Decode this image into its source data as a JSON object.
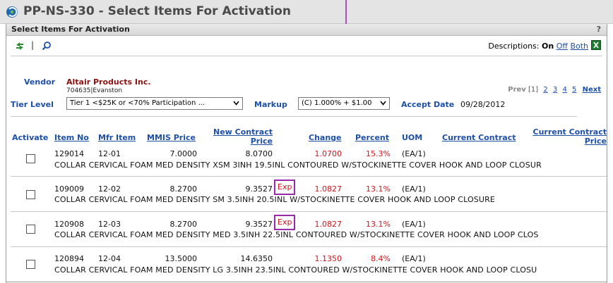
{
  "window": {
    "title": "PP-NS-330 - Select Items For Activation"
  },
  "panel": {
    "title": "Select Items For Activation",
    "help": "?"
  },
  "toolbar": {
    "separator": "|",
    "descriptions_label": "Descriptions:",
    "on": "On",
    "off": "Off",
    "both": "Both"
  },
  "pager": {
    "prev": "Prev",
    "current": "[1]",
    "pages": [
      "2",
      "3",
      "4",
      "5"
    ],
    "next": "Next"
  },
  "vendor": {
    "label": "Vendor",
    "name": "Altair Products Inc.",
    "sub": "704635|Evanston"
  },
  "tier": {
    "label": "Tier Level",
    "value": "Tier 1 <$25K or <70% Participation ..."
  },
  "markup": {
    "label": "Markup",
    "value": "(C) 1.000% + $1.00"
  },
  "accept": {
    "label": "Accept Date",
    "value": "09/28/2012"
  },
  "columns": {
    "activate": "Activate",
    "item_no": "Item No",
    "mfr_item": "Mfr Item",
    "mmis_price": "MMIS Price",
    "new_contract_price_1": "New Contract",
    "new_contract_price_2": "Price",
    "change": "Change",
    "percent": "Percent",
    "uom": "UOM",
    "current_contract": "Current Contract",
    "current_contract_price_1": "Current Contract",
    "current_contract_price_2": "Price"
  },
  "rows": [
    {
      "item_no": "129014",
      "mfr_item": "12-01",
      "mmis_price": "7.0000",
      "new_price": "8.0700",
      "exp": "",
      "change": "1.0700",
      "percent": "15.3%",
      "uom": "(EA/1)",
      "description": "COLLAR CERVICAL FOAM MED DENSITY XSM 3INH 19.5INL CONTOURED W/STOCKINETTE COVER HOOK AND LOOP CLOSUR"
    },
    {
      "item_no": "109009",
      "mfr_item": "12-02",
      "mmis_price": "8.2700",
      "new_price": "9.3527",
      "exp": "Exp",
      "change": "1.0827",
      "percent": "13.1%",
      "uom": "(EA/1)",
      "description": "COLLAR CERVICAL FOAM MED DENSITY SM 3.5INH 20.5INL W/STOCKINETTE COVER HOOK AND LOOP CLOSURE"
    },
    {
      "item_no": "120908",
      "mfr_item": "12-03",
      "mmis_price": "8.2700",
      "new_price": "9.3527",
      "exp": "Exp",
      "change": "1.0827",
      "percent": "13.1%",
      "uom": "(EA/1)",
      "description": "COLLAR CERVICAL FOAM MED DENSITY MED 3.5INH 22.5INL CONTOURED W/STOCKINETTE COVER HOOK AND LOOP CLOS"
    },
    {
      "item_no": "120894",
      "mfr_item": "12-04",
      "mmis_price": "13.5000",
      "new_price": "14.6350",
      "exp": "",
      "change": "1.1350",
      "percent": "8.4%",
      "uom": "(EA/1)",
      "description": "COLLAR CERVICAL FOAM MED DENSITY LG 3.5INH 23.5INL CONTOURED W/STOCKINETTE COVER HOOK AND LOOP CLOSU"
    }
  ],
  "colors": {
    "link": "#1d4fa7",
    "vendor": "#8b1010",
    "red": "#d0141a",
    "highlight": "#9b2aa8",
    "arrow": "#a020c0"
  },
  "icons": {
    "refresh": "refresh-arrows-icon",
    "search": "magnifier-icon",
    "excel": "excel-icon",
    "logo": "app-logo-icon",
    "dropdown": "chevron-down-icon"
  }
}
